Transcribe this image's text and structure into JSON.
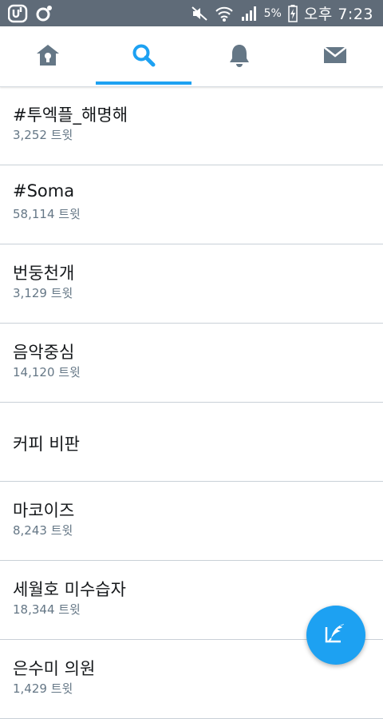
{
  "status_bar": {
    "battery_percent": "5%",
    "time": "오후 7:23",
    "icons": [
      "u-plus-icon",
      "chat-bubble-icon",
      "mute-icon",
      "wifi-icon",
      "signal-icon",
      "battery-charging-icon"
    ]
  },
  "tabs": [
    {
      "name": "home",
      "icon": "home-icon",
      "selected": false
    },
    {
      "name": "search",
      "icon": "search-icon",
      "selected": true
    },
    {
      "name": "notifications",
      "icon": "bell-icon",
      "selected": false
    },
    {
      "name": "messages",
      "icon": "envelope-icon",
      "selected": false
    }
  ],
  "colors": {
    "accent": "#1da1f2",
    "inactive_icon": "#657786",
    "status_bar": "#5f6b78",
    "text_primary": "#14171a",
    "text_secondary": "#657786"
  },
  "trends": [
    {
      "name": "#투엑플_해명해",
      "count": "3,252 트윗"
    },
    {
      "name": "#Soma",
      "count": "58,114 트윗"
    },
    {
      "name": "번둥천개",
      "count": "3,129 트윗"
    },
    {
      "name": "음악중심",
      "count": "14,120 트윗"
    },
    {
      "name": "커피 비판",
      "count": ""
    },
    {
      "name": "마코이즈",
      "count": "8,243 트윗"
    },
    {
      "name": "세월호 미수습자",
      "count": "18,344 트윗"
    },
    {
      "name": "은수미 의원",
      "count": "1,429 트윗"
    }
  ],
  "fab": {
    "icon": "compose-tweet-icon"
  }
}
